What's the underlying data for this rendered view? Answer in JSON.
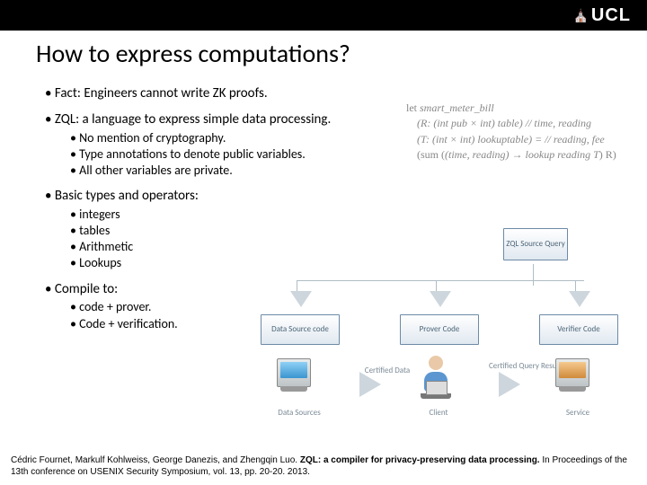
{
  "header": {
    "logo_text": "UCL"
  },
  "title": "How to express computations?",
  "bullets": {
    "b1": "Fact: Engineers cannot write ZK proofs.",
    "b2": "ZQL: a language to express simple data processing.",
    "b2s": {
      "a": "No mention of cryptography.",
      "b": "Type annotations to denote public variables.",
      "c": "All other variables are private."
    },
    "b3": "Basic types and operators:",
    "b3s": {
      "a": "integers",
      "b": "tables",
      "c": "Arithmetic",
      "d": "Lookups"
    },
    "b4": "Compile to:",
    "b4s": {
      "a": "code + prover.",
      "b": "Code + verification."
    }
  },
  "codefig": {
    "l1_a": "let ",
    "l1_b": "smart_meter_bill",
    "l2": "(R: (int pub × int) table) // time, reading",
    "l3": "(T: (int × int) lookuptable) = // reading, fee",
    "l4_a": "(sum (",
    "l4_b": "(time, reading) → lookup reading T",
    "l4_c": ") R)"
  },
  "diagram": {
    "srcq": "ZQL Source Query",
    "dsrc": "Data Source code",
    "prov": "Prover Code",
    "verif": "Verifier Code",
    "cert": "Certified Data",
    "cqr": "Certified Query Results",
    "lbl_ds": "Data Sources",
    "lbl_cl": "Client",
    "lbl_sv": "Service"
  },
  "footer": {
    "authors": "Cédric Fournet, Markulf Kohlweiss, George Danezis, and Zhengqin Luo. ",
    "title": "ZQL: a compiler for privacy-preserving data processing.",
    "rest": " In Proceedings of the 13th conference on USENIX Security Symposium, vol. 13, pp. 20-20. 2013."
  }
}
